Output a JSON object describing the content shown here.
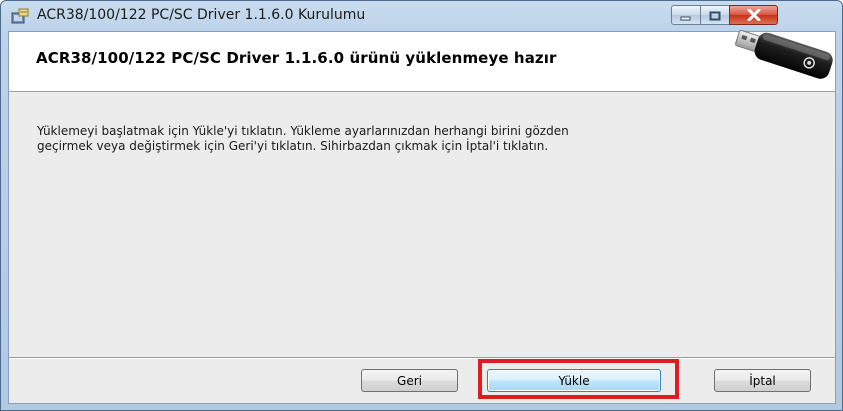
{
  "window": {
    "title": "ACR38/100/122 PC/SC Driver 1.1.6.0 Kurulumu"
  },
  "banner": {
    "title": "ACR38/100/122 PC/SC Driver 1.1.6.0 ürünü yüklenmeye hazır"
  },
  "body": {
    "line1": "Yüklemeyi başlatmak için Yükle'yi tıklatın. Yükleme ayarlarınızdan herhangi birini gözden",
    "line2": "geçirmek veya değiştirmek için Geri'yi tıklatın. Sihirbazdan çıkmak için İptal'i tıklatın."
  },
  "buttons": {
    "back": "Geri",
    "install": "Yükle",
    "cancel": "İptal"
  },
  "highlight": {
    "target": "install-button",
    "color": "#e01b22"
  },
  "icons": {
    "app": "installer-icon",
    "banner": "usb-smartcard-reader-icon",
    "minimize": "minimize-icon",
    "maximize": "maximize-icon",
    "close": "close-icon"
  }
}
